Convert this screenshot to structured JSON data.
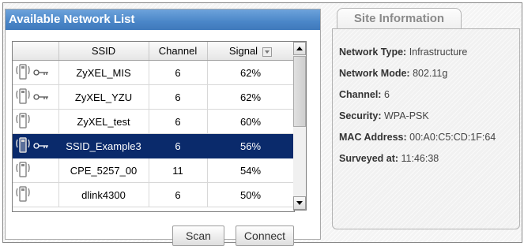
{
  "left_panel": {
    "title": "Available Network List",
    "columns": [
      "",
      "SSID",
      "Channel",
      "Signal"
    ],
    "rows": [
      {
        "ssid": "ZyXEL_MIS",
        "channel": "6",
        "signal": "62%",
        "secured": true,
        "selected": false
      },
      {
        "ssid": "ZyXEL_YZU",
        "channel": "6",
        "signal": "62%",
        "secured": true,
        "selected": false
      },
      {
        "ssid": "ZyXEL_test",
        "channel": "6",
        "signal": "60%",
        "secured": false,
        "selected": false
      },
      {
        "ssid": "SSID_Example3",
        "channel": "6",
        "signal": "56%",
        "secured": true,
        "selected": true
      },
      {
        "ssid": "CPE_5257_00",
        "channel": "11",
        "signal": "54%",
        "secured": false,
        "selected": false
      },
      {
        "ssid": "dlink4300",
        "channel": "6",
        "signal": "50%",
        "secured": false,
        "selected": false
      }
    ],
    "buttons": {
      "scan": "Scan",
      "connect": "Connect"
    }
  },
  "site_info": {
    "tab_label": "Site Information",
    "network_type": {
      "label": "Network Type:",
      "value": "Infrastructure"
    },
    "network_mode": {
      "label": "Network Mode:",
      "value": "802.11g"
    },
    "channel": {
      "label": "Channel:",
      "value": "6"
    },
    "security": {
      "label": "Security:",
      "value": "WPA-PSK"
    },
    "mac_address": {
      "label": "MAC Address:",
      "value": "00:A0:C5:CD:1F:64"
    },
    "surveyed_at": {
      "label": "Surveyed at:",
      "value": "11:46:38"
    }
  },
  "icons": {
    "access_point": "access-point-icon",
    "key": "key-icon",
    "sort": "sort-icon"
  },
  "colors": {
    "header_blue": "#4a86c8",
    "selected_row": "#0a2a6b"
  }
}
